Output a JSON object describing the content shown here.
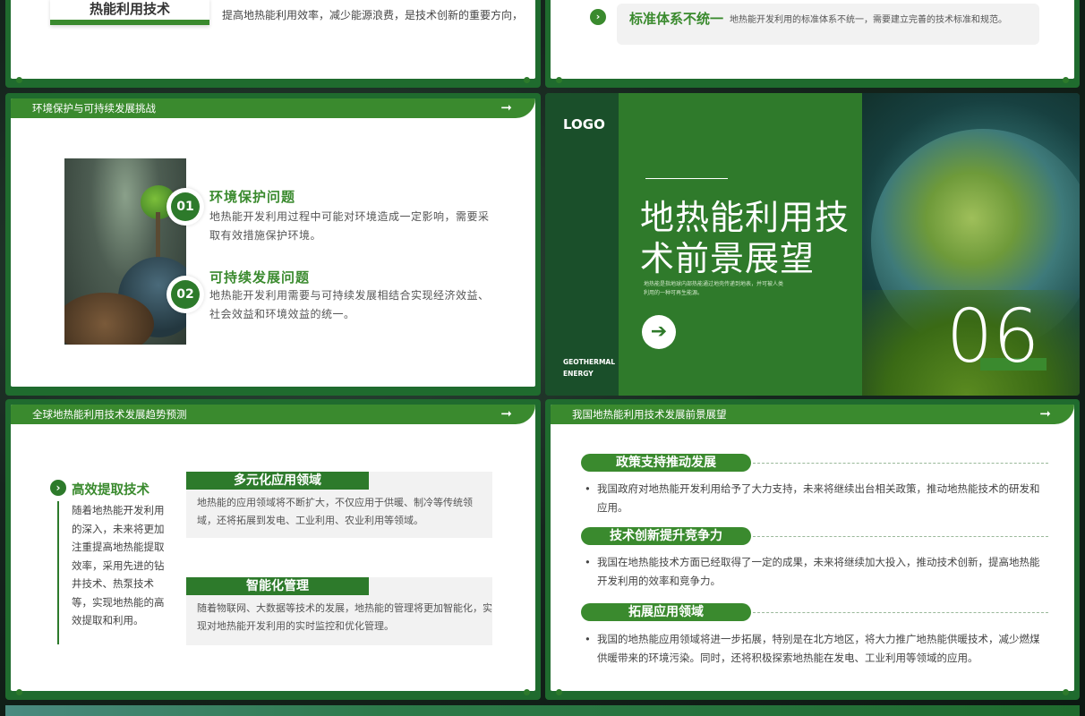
{
  "s1": {
    "box_title": "热能利用技术",
    "text": "提高地热能利用效率，减少能源浪费，是技术创新的重要方向，"
  },
  "s2": {
    "icon": "chevron-right-icon",
    "title": "标准体系不统一",
    "text": "地热能开发利用的标准体系不统一，需要建立完善的技术标准和规范。"
  },
  "s3": {
    "header": "环境保护与可持续发展挑战",
    "items": [
      {
        "num": "01",
        "title": "环境保护问题",
        "text": "地热能开发利用过程中可能对环境造成一定影响，需要采取有效措施保护环境。"
      },
      {
        "num": "02",
        "title": "可持续发展问题",
        "text": "地热能开发利用需要与可持续发展相结合实现经济效益、社会效益和环境效益的统一。"
      }
    ]
  },
  "s4": {
    "logo": "LOGO",
    "title_line1": "地热能利用技",
    "title_line2": "术前景展望",
    "subtitle_line1": "地热能是指地球内部热能通过地壳传递到地表，并可被人类",
    "subtitle_line2": "利用的一种可再生能源。",
    "eng_line1": "GEOTHERMAL",
    "eng_line2": "ENERGY",
    "number": "06"
  },
  "s5": {
    "header": "全球地热能利用技术发展趋势预测",
    "left_title": "高效提取技术",
    "left_text": "随着地热能开发利用的深入，未来将更加注重提高地热能提取效率，采用先进的钻井技术、热泵技术等，实现地热能的高效提取和利用。",
    "boxes": [
      {
        "title": "多元化应用领域",
        "text": "地热能的应用领域将不断扩大，不仅应用于供暖、制冷等传统领域，还将拓展到发电、工业利用、农业利用等领域。"
      },
      {
        "title": "智能化管理",
        "text": "随着物联网、大数据等技术的发展，地热能的管理将更加智能化，实现对地热能开发利用的实时监控和优化管理。"
      }
    ]
  },
  "s6": {
    "header": "我国地热能利用技术发展前景展望",
    "sections": [
      {
        "title": "政策支持推动发展",
        "text": "我国政府对地热能开发利用给予了大力支持，未来将继续出台相关政策，推动地热能技术的研发和应用。"
      },
      {
        "title": "技术创新提升竞争力",
        "text": "我国在地热能技术方面已经取得了一定的成果，未来将继续加大投入，推动技术创新，提高地热能开发利用的效率和竞争力。"
      },
      {
        "title": "拓展应用领域",
        "text": "我国的地热能应用领域将进一步拓展，特别是在北方地区，将大力推广地热能供暖技术，减少燃煤供暖带来的环境污染。同时，还将积极探索地热能在发电、工业利用等领域的应用。"
      }
    ]
  },
  "colors": {
    "primary_green": "#3a8a2e",
    "dark_green": "#1f6b2e"
  }
}
